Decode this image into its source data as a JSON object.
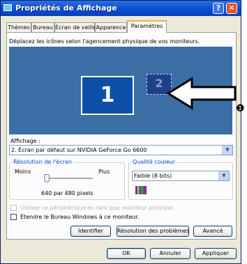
{
  "window": {
    "title": "Propriétés de Affichage",
    "help_label": "?",
    "close_label": "✕"
  },
  "tabs": [
    "Thèmes",
    "Bureau",
    "Écran de veille",
    "Apparence",
    "Paramètres"
  ],
  "active_tab": "Paramètres",
  "description": "Déplacez les icônes selon l'agencement physique de vos moniteurs.",
  "monitors": [
    {
      "number": "1",
      "selected": true
    },
    {
      "number": "2",
      "selected": false
    }
  ],
  "annotation": {
    "marker": "❶"
  },
  "affichage": {
    "label": "Affichage :",
    "value": "2. Écran par défaut sur NVIDIA GeForce Go 6600"
  },
  "resolution": {
    "title": "Résolution de l'écran",
    "min_label": "Moins",
    "max_label": "Plus",
    "value_text": "640 par 480 pixels"
  },
  "color_quality": {
    "title": "Qualité couleur",
    "value": "Faible (8 bits)",
    "palette_colors": [
      "#7a2f9e",
      "#e7c600",
      "#2a66c8",
      "#2f9f4a",
      "#c03030",
      "#7a2f9e"
    ]
  },
  "checkboxes": [
    {
      "label": "Utiliser ce périphérique en tant que moniteur principal.",
      "checked": false,
      "enabled": false
    },
    {
      "label": "Étendre le Bureau Windows à ce moniteur.",
      "checked": false,
      "enabled": true
    }
  ],
  "panel_buttons": [
    "Identifier",
    "Résolution des problèmes",
    "Avancé"
  ],
  "dialog_buttons": [
    "OK",
    "Annuler",
    "Appliquer"
  ],
  "colors": {
    "titlebar": "#0a4dd0",
    "desktop_preview": "#3a6ea5",
    "monitor_fill": "#0b4fa8",
    "tab_highlight": "#f3b13b",
    "group_title": "#0046d5"
  }
}
